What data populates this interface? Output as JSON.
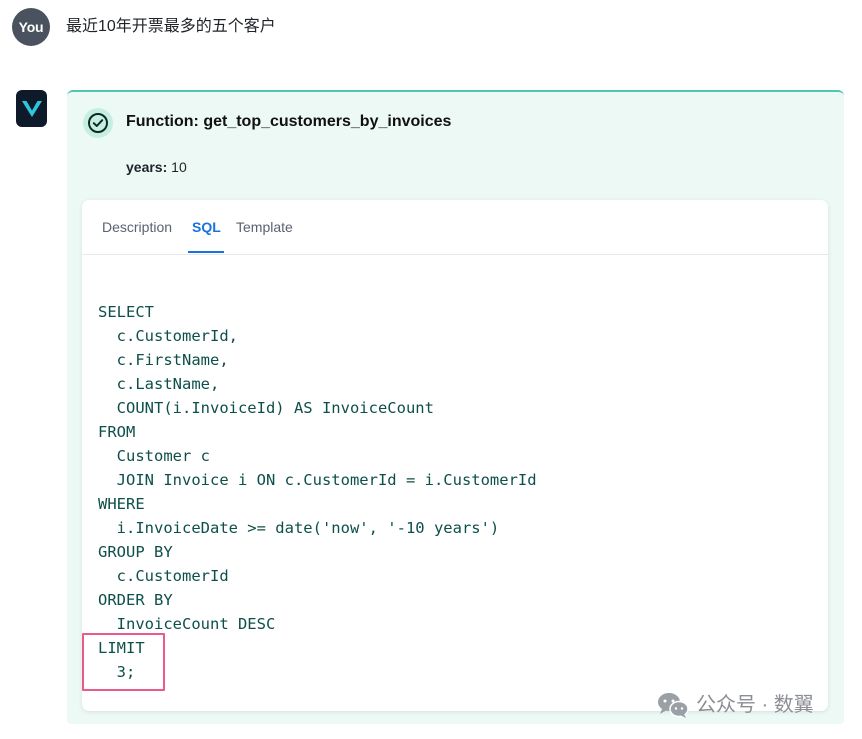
{
  "user": {
    "avatar_label": "You",
    "message": "最近10年开票最多的五个客户"
  },
  "function_call": {
    "title": "Function: get_top_customers_by_invoices",
    "param_key": "years:",
    "param_value": "10",
    "status_icon": "check-circle-icon"
  },
  "tabs": [
    {
      "label": "Description",
      "active": false
    },
    {
      "label": "SQL",
      "active": true
    },
    {
      "label": "Template",
      "active": false
    }
  ],
  "sql_code": "SELECT\n  c.CustomerId,\n  c.FirstName,\n  c.LastName,\n  COUNT(i.InvoiceId) AS InvoiceCount\nFROM\n  Customer c\n  JOIN Invoice i ON c.CustomerId = i.CustomerId\nWHERE\n  i.InvoiceDate >= date('now', '-10 years')\nGROUP BY\n  c.CustomerId\nORDER BY\n  InvoiceCount DESC\nLIMIT\n  3;",
  "watermark": "公众号 · 数翼",
  "colors": {
    "card_bg": "#edf9f5",
    "card_accent": "#4fc7ad",
    "active_tab": "#1a73d9",
    "code_text": "#0d4f4a",
    "highlight_border": "#ea5a8e"
  }
}
